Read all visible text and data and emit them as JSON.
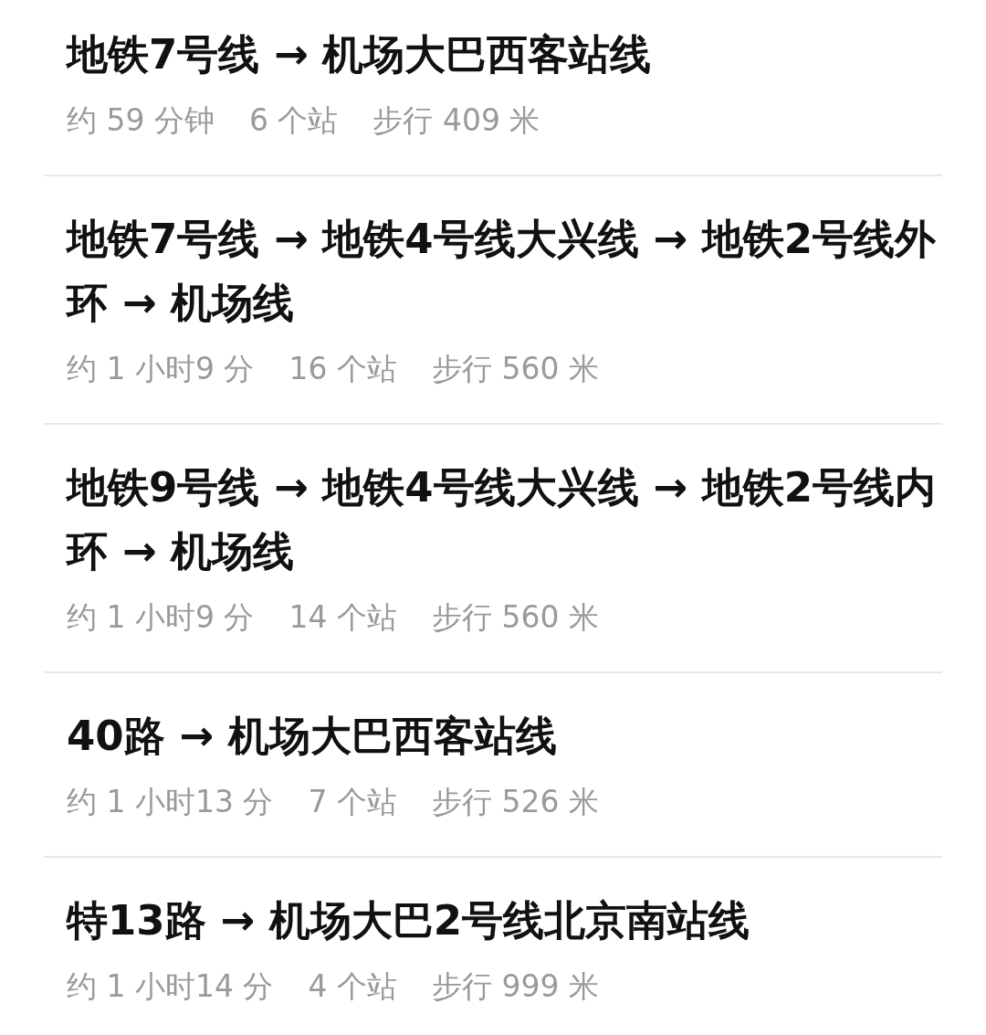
{
  "routes": [
    {
      "title": "地铁7号线 → 机场大巴西客站线",
      "duration": "约 59 分钟",
      "stops": "6 个站",
      "walk": "步行 409 米"
    },
    {
      "title": "地铁7号线 → 地铁4号线大兴线 → 地铁2号线外环 → 机场线",
      "duration": "约 1 小时9 分",
      "stops": "16 个站",
      "walk": "步行 560 米"
    },
    {
      "title": "地铁9号线 → 地铁4号线大兴线 → 地铁2号线内环 → 机场线",
      "duration": "约 1 小时9 分",
      "stops": "14 个站",
      "walk": "步行 560 米"
    },
    {
      "title": "40路 → 机场大巴西客站线",
      "duration": "约 1 小时13 分",
      "stops": "7 个站",
      "walk": "步行 526 米"
    },
    {
      "title": "特13路 → 机场大巴2号线北京南站线",
      "duration": "约 1 小时14 分",
      "stops": "4 个站",
      "walk": "步行 999 米"
    }
  ]
}
